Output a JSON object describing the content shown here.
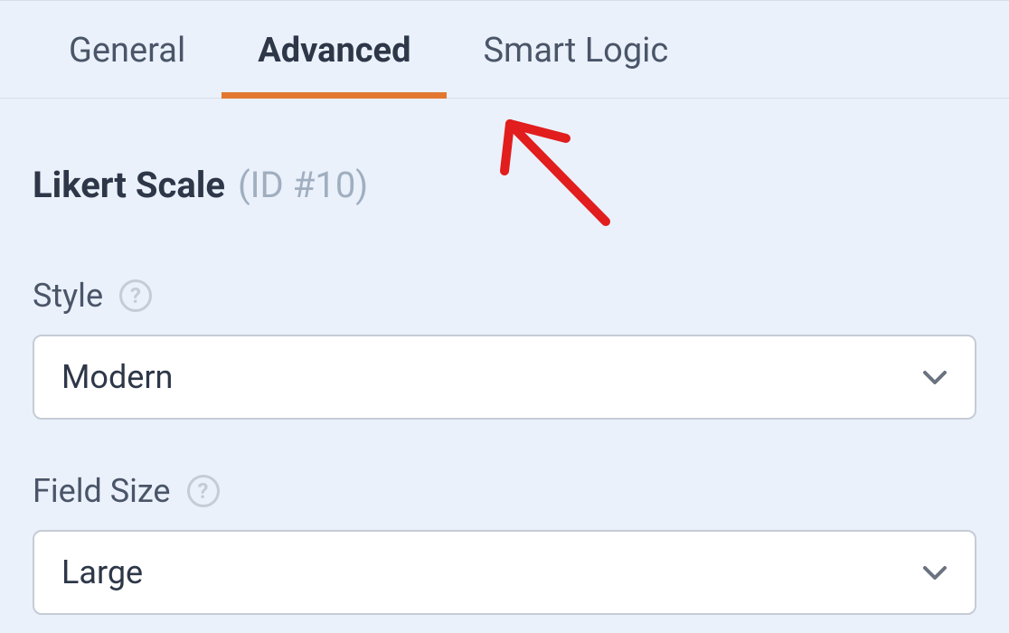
{
  "tabs": [
    {
      "label": "General",
      "active": false
    },
    {
      "label": "Advanced",
      "active": true
    },
    {
      "label": "Smart Logic",
      "active": false
    }
  ],
  "section": {
    "title": "Likert Scale",
    "id_label": "(ID #10)"
  },
  "fields": {
    "style": {
      "label": "Style",
      "value": "Modern"
    },
    "field_size": {
      "label": "Field Size",
      "value": "Large"
    }
  }
}
